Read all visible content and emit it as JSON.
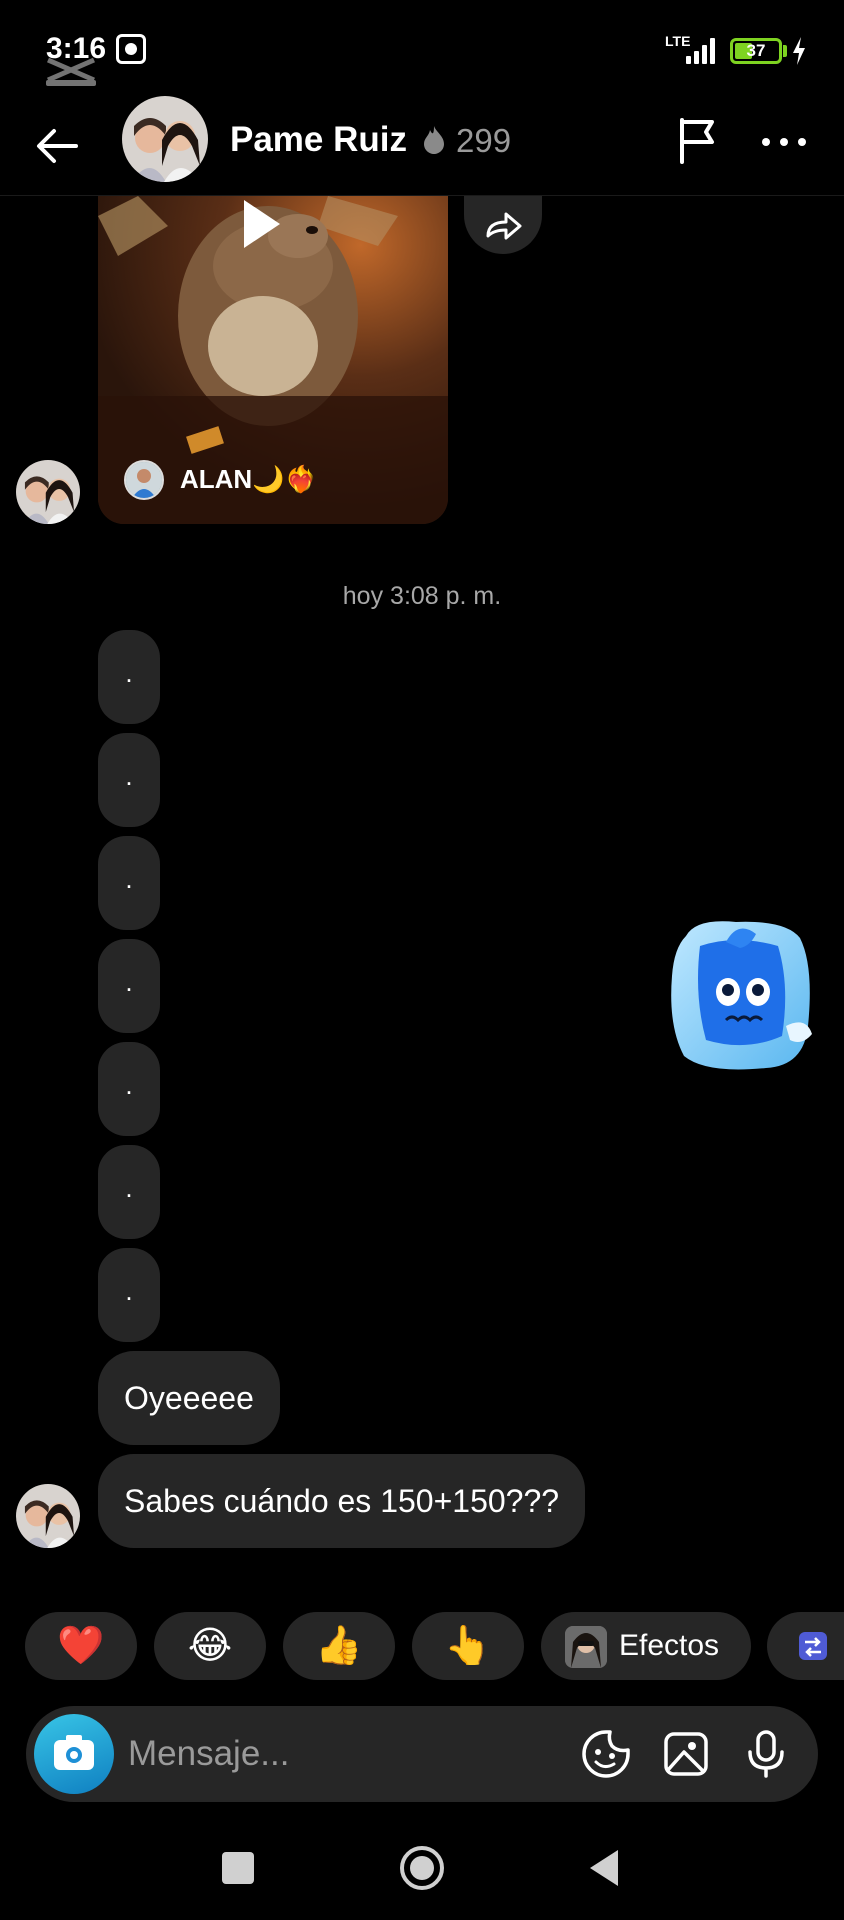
{
  "status_bar": {
    "time": "3:16",
    "network": "LTE",
    "battery_level": "37"
  },
  "header": {
    "contact_name": "Pame Ruiz",
    "streak_count": "299"
  },
  "shared_post": {
    "author_name": "ALAN🌙❤️‍🔥"
  },
  "timestamp": "hoy 3:08 p. m.",
  "messages": {
    "dots": [
      ".",
      ".",
      ".",
      ".",
      ".",
      ".",
      "."
    ],
    "text_1": "Oyeeeee",
    "text_2": "Sabes cuándo es 150+150???"
  },
  "quick_reactions": {
    "items": [
      "❤️",
      "😂",
      "👍",
      "👆"
    ],
    "effects_label": "Efectos"
  },
  "composer": {
    "placeholder": "Mensaje..."
  },
  "colors": {
    "background": "#000000",
    "bubble": "#262626",
    "battery": "#7ed321",
    "camera_accent": "#1da1f2"
  }
}
